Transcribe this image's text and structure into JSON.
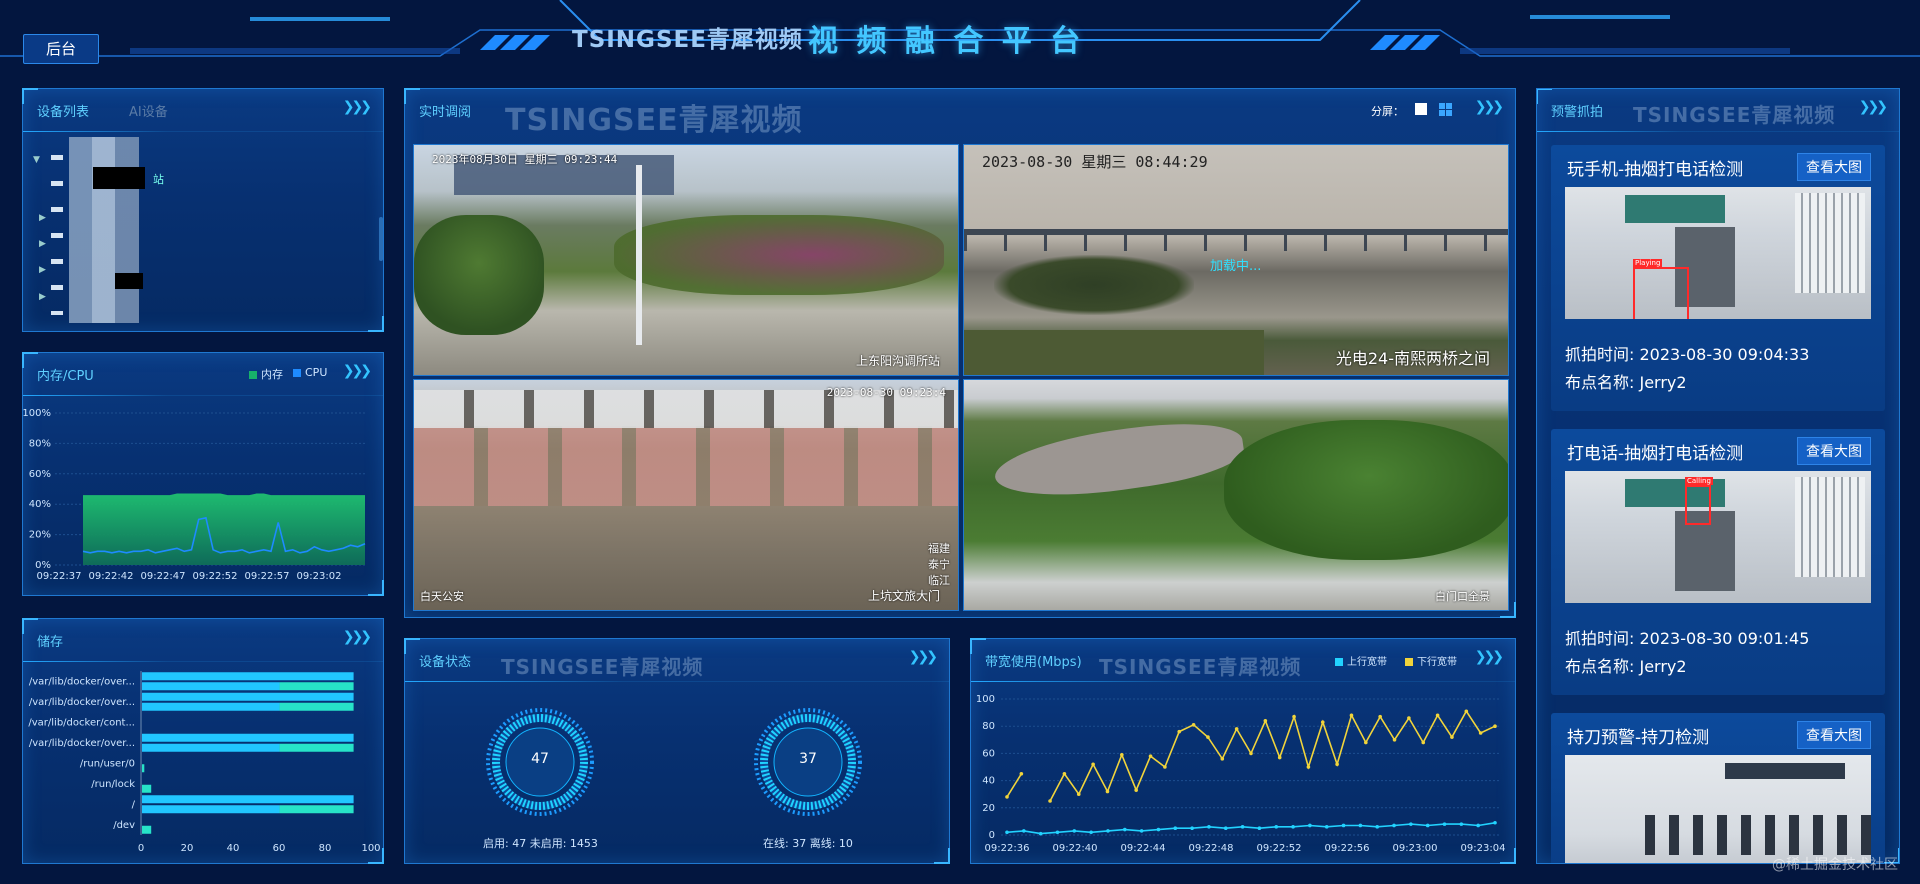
{
  "header": {
    "brand": "TSINGSEE青犀视频",
    "title": "视 频 融 合 平 台",
    "back_button": "后台"
  },
  "device_list": {
    "tab_active": "设备列表",
    "tab_inactive": "AI设备",
    "partial_label": "站"
  },
  "memory_cpu": {
    "title": "内存/CPU",
    "legend": [
      "内存",
      "CPU"
    ]
  },
  "storage": {
    "title": "储存"
  },
  "live": {
    "title": "实时调阅",
    "brand": "TSINGSEE青犀视频",
    "split_label": "分屏：",
    "cams": [
      {
        "timestamp": "2023年08月30日 星期三 09:23:44",
        "name": "上东阳沟调所站"
      },
      {
        "timestamp": "2023-08-30  星期三  08:44:29",
        "name": "光电24-南熙两桥之间",
        "overlay": "加载中..."
      },
      {
        "timestamp": "2023-08-30 09:23:4",
        "name": "上坑文旅大门",
        "corner": "福建 泰宁 临江",
        "corner2": "白天公安"
      },
      {
        "timestamp": "",
        "name": "白门口全景"
      }
    ]
  },
  "device_status": {
    "title": "设备状态",
    "brand": "TSINGSEE青犀视频",
    "gauge1_value": "47",
    "gauge2_value": "37",
    "gauge1_caption": "启用: 47  未启用: 1453",
    "gauge2_caption": "在线: 37  离线: 10"
  },
  "bandwidth": {
    "title": "带宽使用(Mbps)",
    "brand": "TSINGSEE青犀视频",
    "legend": [
      "上行宽带",
      "下行宽带"
    ]
  },
  "alerts": {
    "title": "预警抓拍",
    "brand": "TSINGSEE青犀视频",
    "view_button": "查看大图",
    "items": [
      {
        "title": "玩手机-抽烟打电话检测",
        "time_line": "抓拍时间:  2023-08-30 09:04:33",
        "place_line": "布点名称:  Jerry2",
        "tag": "Playing"
      },
      {
        "title": "打电话-抽烟打电话检测",
        "time_line": "抓拍时间:  2023-08-30 09:01:45",
        "place_line": "布点名称:  Jerry2",
        "tag": "Calling"
      },
      {
        "title": "持刀预警-持刀检测"
      }
    ]
  },
  "watermark": "@稀土掘金技术社区",
  "chart_data": [
    {
      "type": "area",
      "title": "内存/CPU",
      "x": [
        "09:22:37",
        "09:22:42",
        "09:22:47",
        "09:22:52",
        "09:22:57",
        "09:23:02"
      ],
      "ylim": [
        0,
        100
      ],
      "yticks": [
        "100%",
        "80%",
        "60%",
        "40%",
        "20%",
        "0%"
      ],
      "series": [
        {
          "name": "内存",
          "color": "#17b26a",
          "values": [
            46,
            46,
            46,
            46,
            46,
            46,
            46,
            46,
            46,
            46,
            46,
            46,
            46,
            47,
            47,
            47,
            47,
            47,
            47,
            47,
            46,
            46,
            46,
            46,
            47,
            47,
            46,
            46,
            46,
            46,
            46,
            46,
            46,
            46,
            46,
            46,
            46,
            46,
            46,
            46
          ]
        },
        {
          "name": "CPU",
          "color": "#1e8bff",
          "values": [
            9,
            8,
            9,
            9,
            8,
            9,
            8,
            9,
            9,
            10,
            8,
            9,
            10,
            11,
            9,
            10,
            30,
            31,
            10,
            8,
            9,
            9,
            10,
            8,
            9,
            10,
            9,
            28,
            9,
            10,
            8,
            9,
            12,
            10,
            9,
            10,
            11,
            13,
            12,
            14
          ]
        }
      ]
    },
    {
      "type": "bar",
      "title": "储存",
      "orientation": "horizontal",
      "categories": [
        "/var/lib/docker/over...",
        "/var/lib/docker/over...",
        "/var/lib/docker/cont...",
        "/var/lib/docker/over...",
        "/run/user/0",
        "/run/lock",
        "/",
        "/dev"
      ],
      "xlim": [
        0,
        100
      ],
      "xticks": [
        0,
        20,
        40,
        60,
        80,
        100
      ],
      "series": [
        {
          "name": "",
          "values": [
            92,
            92,
            0,
            92,
            0,
            0,
            92,
            0
          ]
        },
        {
          "name": "",
          "values": [
            92,
            92,
            0,
            92,
            1,
            4,
            92,
            4
          ]
        }
      ]
    },
    {
      "type": "line",
      "title": "带宽使用(Mbps)",
      "x_ticks": [
        "09:22:36",
        "09:22:40",
        "09:22:44",
        "09:22:48",
        "09:22:52",
        "09:22:56",
        "09:23:00",
        "09:23:04"
      ],
      "ylim": [
        0,
        100
      ],
      "yticks": [
        0,
        20,
        40,
        60,
        80,
        100
      ],
      "series": [
        {
          "name": "上行宽带",
          "color": "#22d3ff",
          "values": [
            2,
            3,
            1,
            2,
            3,
            2,
            3,
            4,
            3,
            4,
            5,
            5,
            6,
            5,
            6,
            5,
            6,
            6,
            7,
            6,
            7,
            7,
            6,
            7,
            8,
            7,
            8,
            8,
            7,
            9
          ]
        },
        {
          "name": "下行宽带",
          "color": "#f1d43b",
          "values": [
            28,
            45,
            null,
            25,
            45,
            30,
            52,
            32,
            59,
            33,
            58,
            50,
            76,
            81,
            72,
            56,
            78,
            60,
            84,
            57,
            87,
            50,
            83,
            52,
            88,
            68,
            87,
            70,
            86,
            68,
            88,
            72,
            91,
            75,
            80
          ]
        }
      ]
    }
  ]
}
